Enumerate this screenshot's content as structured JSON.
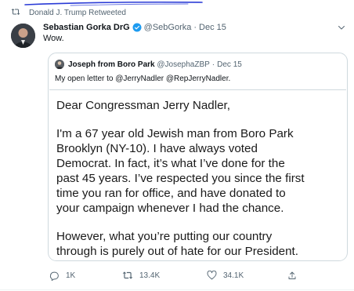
{
  "retweet_context": {
    "text": "Donald J. Trump Retweeted"
  },
  "tweet": {
    "author_name": "Sebastian Gorka DrG",
    "handle": "@SebGorka",
    "separator": "·",
    "date": "Dec 15",
    "text": "Wow."
  },
  "quote": {
    "author_name": "Joseph from Boro Park",
    "handle": "@JosephaZBP",
    "separator": "·",
    "date": "Dec 15",
    "text": "My open letter to @JerryNadler @RepJerryNadler.",
    "letter_lines": [
      "Dear Congressman Jerry Nadler,",
      "I'm a 67 year old Jewish man from Boro Park",
      "Brooklyn (NY-10). I have always voted",
      "Democrat. In fact, it’s what I’ve done for the",
      "past 45 years. I’ve respected you since the first",
      "time you ran for office, and have donated to",
      "your campaign whenever I had the chance.",
      "However, what you’re putting our country",
      "through is purely out of hate for our President."
    ]
  },
  "actions": {
    "replies": "1K",
    "retweets": "13.4K",
    "likes": "34.1K"
  },
  "colors": {
    "verified": "#1d9bf0",
    "scribble": "#2a3bd6",
    "secondary_text": "#536471"
  },
  "icons": [
    "retweet-icon",
    "verified-badge-icon",
    "chevron-down-icon",
    "reply-icon",
    "like-icon",
    "share-icon"
  ]
}
